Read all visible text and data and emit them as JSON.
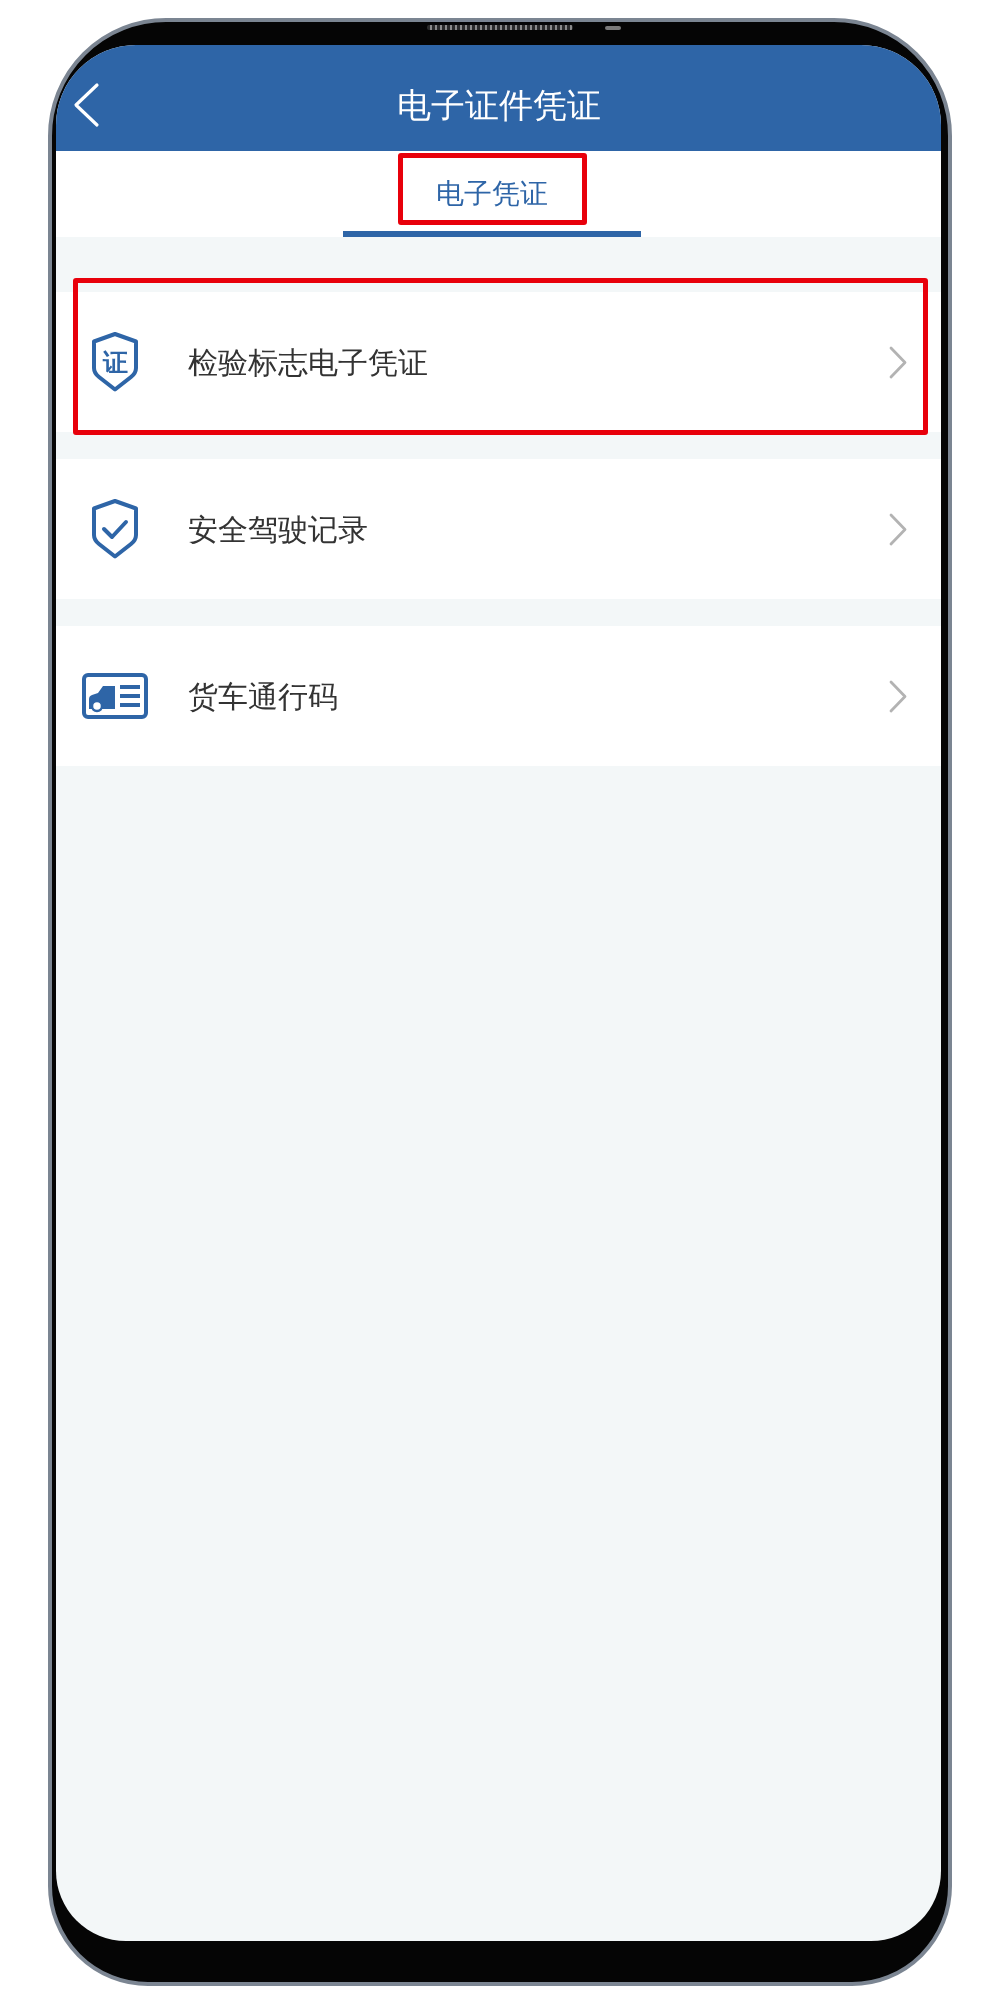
{
  "header": {
    "title": "电子证件凭证"
  },
  "tabs": [
    {
      "label": "电子凭证",
      "selected": true,
      "highlighted": true
    }
  ],
  "items": [
    {
      "kind": "certificate",
      "icon_text": "证",
      "label": "检验标志电子凭证",
      "highlighted": true
    },
    {
      "kind": "safety",
      "label": "安全驾驶记录",
      "highlighted": false
    },
    {
      "kind": "truck",
      "label": "货车通行码",
      "highlighted": false
    }
  ]
}
